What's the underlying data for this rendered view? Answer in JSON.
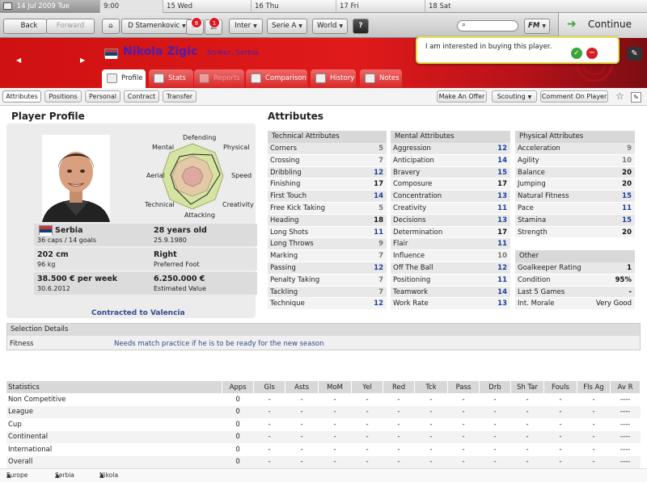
{
  "calendar": {
    "current": "14 Jul 2009",
    "weekday": "Tue",
    "time": "9:00",
    "days": [
      "15 Wed",
      "16 Thu",
      "17 Fri",
      "18 Sat"
    ]
  },
  "toolbar": {
    "back": "Back",
    "forward": "Forward",
    "manager": "D Stamenkovic",
    "mail_count": "8",
    "news_count": "1",
    "club": "Inter",
    "league": "Serie A",
    "world": "World",
    "help": "?",
    "fm": "FM",
    "continue": "Continue"
  },
  "header": {
    "name": "Nikola Zigic",
    "role": "Striker, Serbia",
    "message": "I am interested in buying this player."
  },
  "tabs": [
    "Profile",
    "Stats",
    "Reports",
    "Comparison",
    "History",
    "Notes"
  ],
  "subnav": [
    "Attributes",
    "Positions",
    "Personal",
    "Contract",
    "Transfer"
  ],
  "actions": [
    "Make An Offer",
    "Scouting",
    "Comment On Player"
  ],
  "profile": {
    "title": "Player Profile",
    "radar_labels": [
      "Defending",
      "Physical",
      "Speed",
      "Creativity",
      "Attacking",
      "Technical",
      "Aerial",
      "Mental"
    ],
    "nation": "Serbia",
    "caps": "36 caps / 14 goals",
    "age": "28 years old",
    "dob": "25.9.1980",
    "height": "202 cm",
    "weight": "96 kg",
    "foot": "Right",
    "foot_label": "Preferred Foot",
    "wage": "38.500 € per week",
    "contract_end": "30.6.2012",
    "value": "6.250.000 €",
    "value_label": "Estimated Value",
    "contracted": "Contracted to Valencia"
  },
  "attributes": {
    "title": "Attributes",
    "technical": {
      "header": "Technical Attributes",
      "rows": [
        [
          "Corners",
          "5"
        ],
        [
          "Crossing",
          "7"
        ],
        [
          "Dribbling",
          "12"
        ],
        [
          "Finishing",
          "17"
        ],
        [
          "First Touch",
          "14"
        ],
        [
          "Free Kick Taking",
          "5"
        ],
        [
          "Heading",
          "18"
        ],
        [
          "Long Shots",
          "11"
        ],
        [
          "Long Throws",
          "9"
        ],
        [
          "Marking",
          "7"
        ],
        [
          "Passing",
          "12"
        ],
        [
          "Penalty Taking",
          "7"
        ],
        [
          "Tackling",
          "7"
        ],
        [
          "Technique",
          "12"
        ]
      ]
    },
    "mental": {
      "header": "Mental Attributes",
      "rows": [
        [
          "Aggression",
          "12"
        ],
        [
          "Anticipation",
          "14"
        ],
        [
          "Bravery",
          "15"
        ],
        [
          "Composure",
          "17"
        ],
        [
          "Concentration",
          "13"
        ],
        [
          "Creativity",
          "11"
        ],
        [
          "Decisions",
          "13"
        ],
        [
          "Determination",
          "17"
        ],
        [
          "Flair",
          "11"
        ],
        [
          "Influence",
          "10"
        ],
        [
          "Off The Ball",
          "12"
        ],
        [
          "Positioning",
          "11"
        ],
        [
          "Teamwork",
          "14"
        ],
        [
          "Work Rate",
          "13"
        ]
      ]
    },
    "physical": {
      "header": "Physical Attributes",
      "rows": [
        [
          "Acceleration",
          "9"
        ],
        [
          "Agility",
          "10"
        ],
        [
          "Balance",
          "20"
        ],
        [
          "Jumping",
          "20"
        ],
        [
          "Natural Fitness",
          "15"
        ],
        [
          "Pace",
          "11"
        ],
        [
          "Stamina",
          "15"
        ],
        [
          "Strength",
          "20"
        ]
      ]
    },
    "other": {
      "header": "Other",
      "rows": [
        [
          "Goalkeeper Rating",
          "1"
        ],
        [
          "Condition",
          "95%"
        ],
        [
          "Last 5 Games",
          "-"
        ],
        [
          "Int. Morale",
          "Very Good"
        ]
      ]
    }
  },
  "selection": {
    "header": "Selection Details",
    "label": "Fitness",
    "value": "Needs match practice if he is to be ready for the new season"
  },
  "stats": {
    "columns": [
      "Statistics",
      "Apps",
      "Gls",
      "Asts",
      "MoM",
      "Yel",
      "Red",
      "Tck",
      "Pass",
      "Drb",
      "Sh Tar",
      "Fouls",
      "Fls Ag",
      "Av R"
    ],
    "rows": [
      [
        "Non Competitive",
        "0",
        "-",
        "-",
        "-",
        "-",
        "-",
        "-",
        "-",
        "-",
        "-",
        "-",
        "-",
        "----"
      ],
      [
        "League",
        "0",
        "-",
        "-",
        "-",
        "-",
        "-",
        "-",
        "-",
        "-",
        "-",
        "-",
        "-",
        "----"
      ],
      [
        "Cup",
        "0",
        "-",
        "-",
        "-",
        "-",
        "-",
        "-",
        "-",
        "-",
        "-",
        "-",
        "-",
        "----"
      ],
      [
        "Continental",
        "0",
        "-",
        "-",
        "-",
        "-",
        "-",
        "-",
        "-",
        "-",
        "-",
        "-",
        "-",
        "----"
      ],
      [
        "International",
        "0",
        "-",
        "-",
        "-",
        "-",
        "-",
        "-",
        "-",
        "-",
        "-",
        "-",
        "-",
        "----"
      ],
      [
        "Overall",
        "0",
        "-",
        "-",
        "-",
        "-",
        "-",
        "-",
        "-",
        "-",
        "-",
        "-",
        "-",
        "----"
      ]
    ]
  },
  "breadcrumb": [
    "Europe",
    "Serbia",
    "Nikola Zigic"
  ],
  "colors": {
    "header_red": "#d81616",
    "accent_blue": "#2d4b8a",
    "attr_blue": "#1b3d9a"
  }
}
